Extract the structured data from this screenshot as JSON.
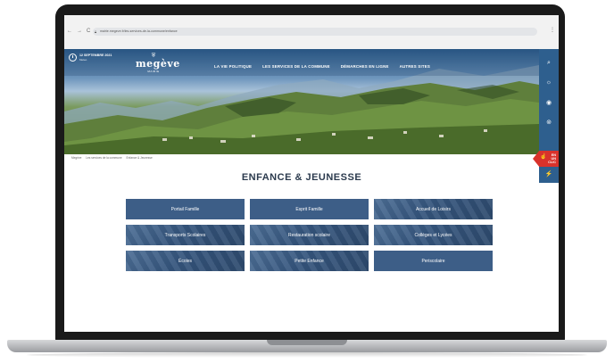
{
  "browser": {
    "url": "mairie.megeve.fr/les-services-de-la-commune/enfance",
    "nav_back": "←",
    "nav_forward": "→",
    "nav_reload": "C",
    "menu_dots": "⋮"
  },
  "header": {
    "date_line": "12 SEPTEMBRE 2021",
    "date_sub": "Meteo",
    "logo_mark": "⛨",
    "logo_name": "megève",
    "logo_sub": "MAIRIE",
    "menu": [
      {
        "label": "LA VIE POLITIQUE"
      },
      {
        "label": "LES SERVICES DE LA COMMUNE"
      },
      {
        "label": "DÉMARCHES EN LIGNE"
      },
      {
        "label": "AUTRES SITES"
      }
    ]
  },
  "side_rail": {
    "icons": [
      {
        "name": "search-icon",
        "glyph": "⌕"
      },
      {
        "name": "sun-icon",
        "glyph": "☼"
      },
      {
        "name": "location-icon",
        "glyph": "◉"
      },
      {
        "name": "map-pin-icon",
        "glyph": "⊚"
      }
    ],
    "flag_text_1": "EN",
    "flag_text_2": "UN",
    "flag_text_3": "CLIC",
    "bottom_icon": "⚡"
  },
  "breadcrumb": [
    "Megève",
    "Les services de la commune",
    "Enfance & Jeunesse"
  ],
  "page": {
    "title": "ENFANCE & JEUNESSE"
  },
  "tiles": [
    {
      "label": "Portail Famille"
    },
    {
      "label": "Esprit Famille"
    },
    {
      "label": "Accueil de Loisirs"
    },
    {
      "label": "Transports Scolaires"
    },
    {
      "label": "Restauration scolaire"
    },
    {
      "label": "Collèges et Lycées"
    },
    {
      "label": "Écoles"
    },
    {
      "label": "Petite Enfance"
    },
    {
      "label": "Periscolaire"
    }
  ]
}
